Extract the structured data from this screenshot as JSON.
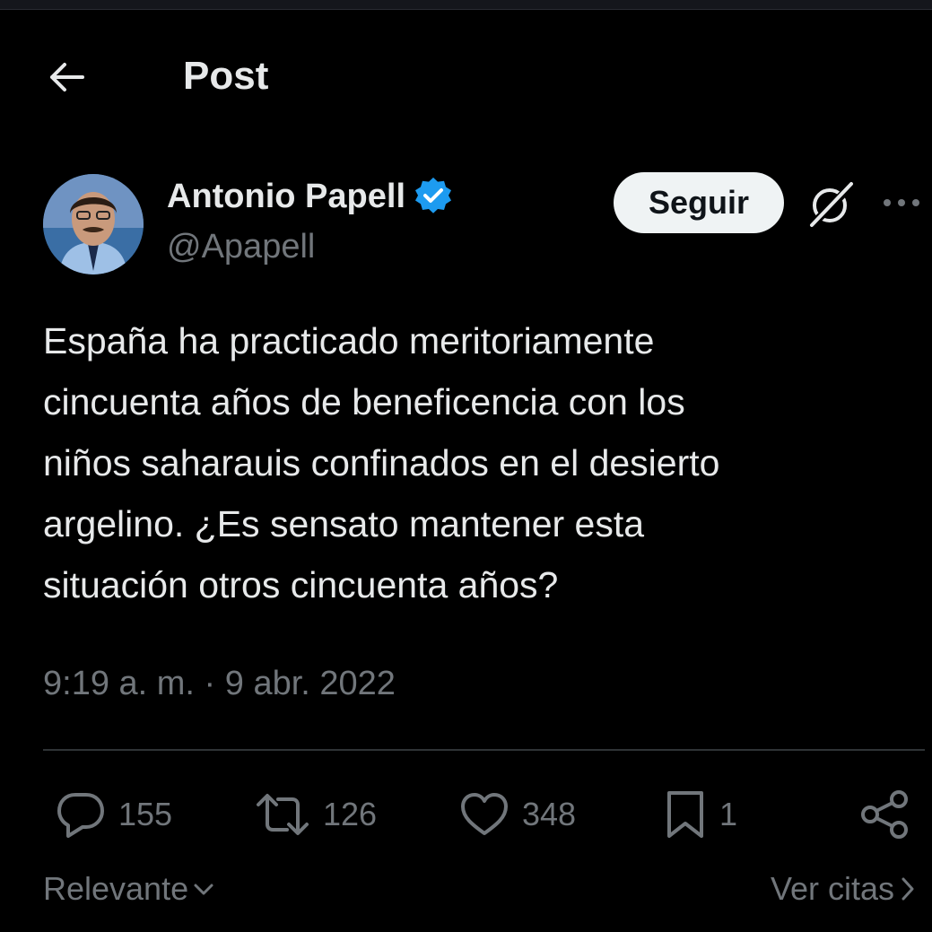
{
  "header": {
    "title": "Post"
  },
  "author": {
    "name": "Antonio Papell",
    "handle": "@Apapell",
    "verified": true
  },
  "actions": {
    "follow_label": "Seguir"
  },
  "post": {
    "text": "España ha practicado meritoriamente\ncincuenta años de beneficencia con los\nniños saharauis confinados en el desierto\nargelino. ¿Es sensato mantener esta\nsituación otros cincuenta años?",
    "timestamp": "9:19 a. m. · 9 abr. 2022"
  },
  "stats": {
    "replies": "155",
    "reposts": "126",
    "likes": "348",
    "bookmarks": "1"
  },
  "footer": {
    "sort_label": "Relevante",
    "quotes_label": "Ver citas"
  },
  "colors": {
    "background": "#000000",
    "text": "#e7e9ea",
    "muted": "#71767b",
    "verified_blue": "#1d9bf0",
    "follow_bg": "#eff3f4"
  },
  "icons": {
    "back": "arrow-left-icon",
    "verified": "verified-badge-icon",
    "grok": "grok-icon",
    "more": "more-horizontal-icon",
    "reply": "reply-icon",
    "repost": "repost-icon",
    "like": "heart-icon",
    "bookmark": "bookmark-icon",
    "share": "share-icon"
  }
}
